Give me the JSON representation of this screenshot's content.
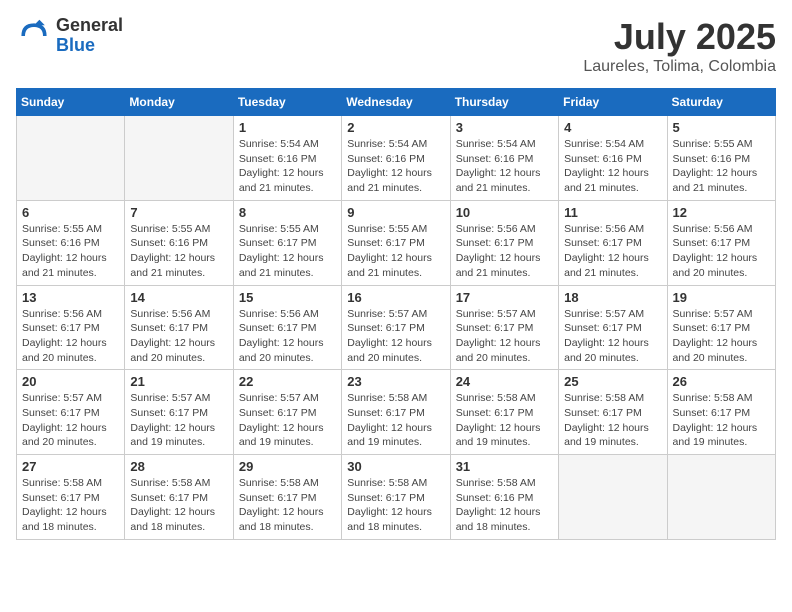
{
  "logo": {
    "general": "General",
    "blue": "Blue"
  },
  "title": {
    "month": "July 2025",
    "location": "Laureles, Tolima, Colombia"
  },
  "headers": [
    "Sunday",
    "Monday",
    "Tuesday",
    "Wednesday",
    "Thursday",
    "Friday",
    "Saturday"
  ],
  "weeks": [
    [
      {
        "day": "",
        "info": ""
      },
      {
        "day": "",
        "info": ""
      },
      {
        "day": "1",
        "info": "Sunrise: 5:54 AM\nSunset: 6:16 PM\nDaylight: 12 hours and 21 minutes."
      },
      {
        "day": "2",
        "info": "Sunrise: 5:54 AM\nSunset: 6:16 PM\nDaylight: 12 hours and 21 minutes."
      },
      {
        "day": "3",
        "info": "Sunrise: 5:54 AM\nSunset: 6:16 PM\nDaylight: 12 hours and 21 minutes."
      },
      {
        "day": "4",
        "info": "Sunrise: 5:54 AM\nSunset: 6:16 PM\nDaylight: 12 hours and 21 minutes."
      },
      {
        "day": "5",
        "info": "Sunrise: 5:55 AM\nSunset: 6:16 PM\nDaylight: 12 hours and 21 minutes."
      }
    ],
    [
      {
        "day": "6",
        "info": "Sunrise: 5:55 AM\nSunset: 6:16 PM\nDaylight: 12 hours and 21 minutes."
      },
      {
        "day": "7",
        "info": "Sunrise: 5:55 AM\nSunset: 6:16 PM\nDaylight: 12 hours and 21 minutes."
      },
      {
        "day": "8",
        "info": "Sunrise: 5:55 AM\nSunset: 6:17 PM\nDaylight: 12 hours and 21 minutes."
      },
      {
        "day": "9",
        "info": "Sunrise: 5:55 AM\nSunset: 6:17 PM\nDaylight: 12 hours and 21 minutes."
      },
      {
        "day": "10",
        "info": "Sunrise: 5:56 AM\nSunset: 6:17 PM\nDaylight: 12 hours and 21 minutes."
      },
      {
        "day": "11",
        "info": "Sunrise: 5:56 AM\nSunset: 6:17 PM\nDaylight: 12 hours and 21 minutes."
      },
      {
        "day": "12",
        "info": "Sunrise: 5:56 AM\nSunset: 6:17 PM\nDaylight: 12 hours and 20 minutes."
      }
    ],
    [
      {
        "day": "13",
        "info": "Sunrise: 5:56 AM\nSunset: 6:17 PM\nDaylight: 12 hours and 20 minutes."
      },
      {
        "day": "14",
        "info": "Sunrise: 5:56 AM\nSunset: 6:17 PM\nDaylight: 12 hours and 20 minutes."
      },
      {
        "day": "15",
        "info": "Sunrise: 5:56 AM\nSunset: 6:17 PM\nDaylight: 12 hours and 20 minutes."
      },
      {
        "day": "16",
        "info": "Sunrise: 5:57 AM\nSunset: 6:17 PM\nDaylight: 12 hours and 20 minutes."
      },
      {
        "day": "17",
        "info": "Sunrise: 5:57 AM\nSunset: 6:17 PM\nDaylight: 12 hours and 20 minutes."
      },
      {
        "day": "18",
        "info": "Sunrise: 5:57 AM\nSunset: 6:17 PM\nDaylight: 12 hours and 20 minutes."
      },
      {
        "day": "19",
        "info": "Sunrise: 5:57 AM\nSunset: 6:17 PM\nDaylight: 12 hours and 20 minutes."
      }
    ],
    [
      {
        "day": "20",
        "info": "Sunrise: 5:57 AM\nSunset: 6:17 PM\nDaylight: 12 hours and 20 minutes."
      },
      {
        "day": "21",
        "info": "Sunrise: 5:57 AM\nSunset: 6:17 PM\nDaylight: 12 hours and 19 minutes."
      },
      {
        "day": "22",
        "info": "Sunrise: 5:57 AM\nSunset: 6:17 PM\nDaylight: 12 hours and 19 minutes."
      },
      {
        "day": "23",
        "info": "Sunrise: 5:58 AM\nSunset: 6:17 PM\nDaylight: 12 hours and 19 minutes."
      },
      {
        "day": "24",
        "info": "Sunrise: 5:58 AM\nSunset: 6:17 PM\nDaylight: 12 hours and 19 minutes."
      },
      {
        "day": "25",
        "info": "Sunrise: 5:58 AM\nSunset: 6:17 PM\nDaylight: 12 hours and 19 minutes."
      },
      {
        "day": "26",
        "info": "Sunrise: 5:58 AM\nSunset: 6:17 PM\nDaylight: 12 hours and 19 minutes."
      }
    ],
    [
      {
        "day": "27",
        "info": "Sunrise: 5:58 AM\nSunset: 6:17 PM\nDaylight: 12 hours and 18 minutes."
      },
      {
        "day": "28",
        "info": "Sunrise: 5:58 AM\nSunset: 6:17 PM\nDaylight: 12 hours and 18 minutes."
      },
      {
        "day": "29",
        "info": "Sunrise: 5:58 AM\nSunset: 6:17 PM\nDaylight: 12 hours and 18 minutes."
      },
      {
        "day": "30",
        "info": "Sunrise: 5:58 AM\nSunset: 6:17 PM\nDaylight: 12 hours and 18 minutes."
      },
      {
        "day": "31",
        "info": "Sunrise: 5:58 AM\nSunset: 6:16 PM\nDaylight: 12 hours and 18 minutes."
      },
      {
        "day": "",
        "info": ""
      },
      {
        "day": "",
        "info": ""
      }
    ]
  ]
}
